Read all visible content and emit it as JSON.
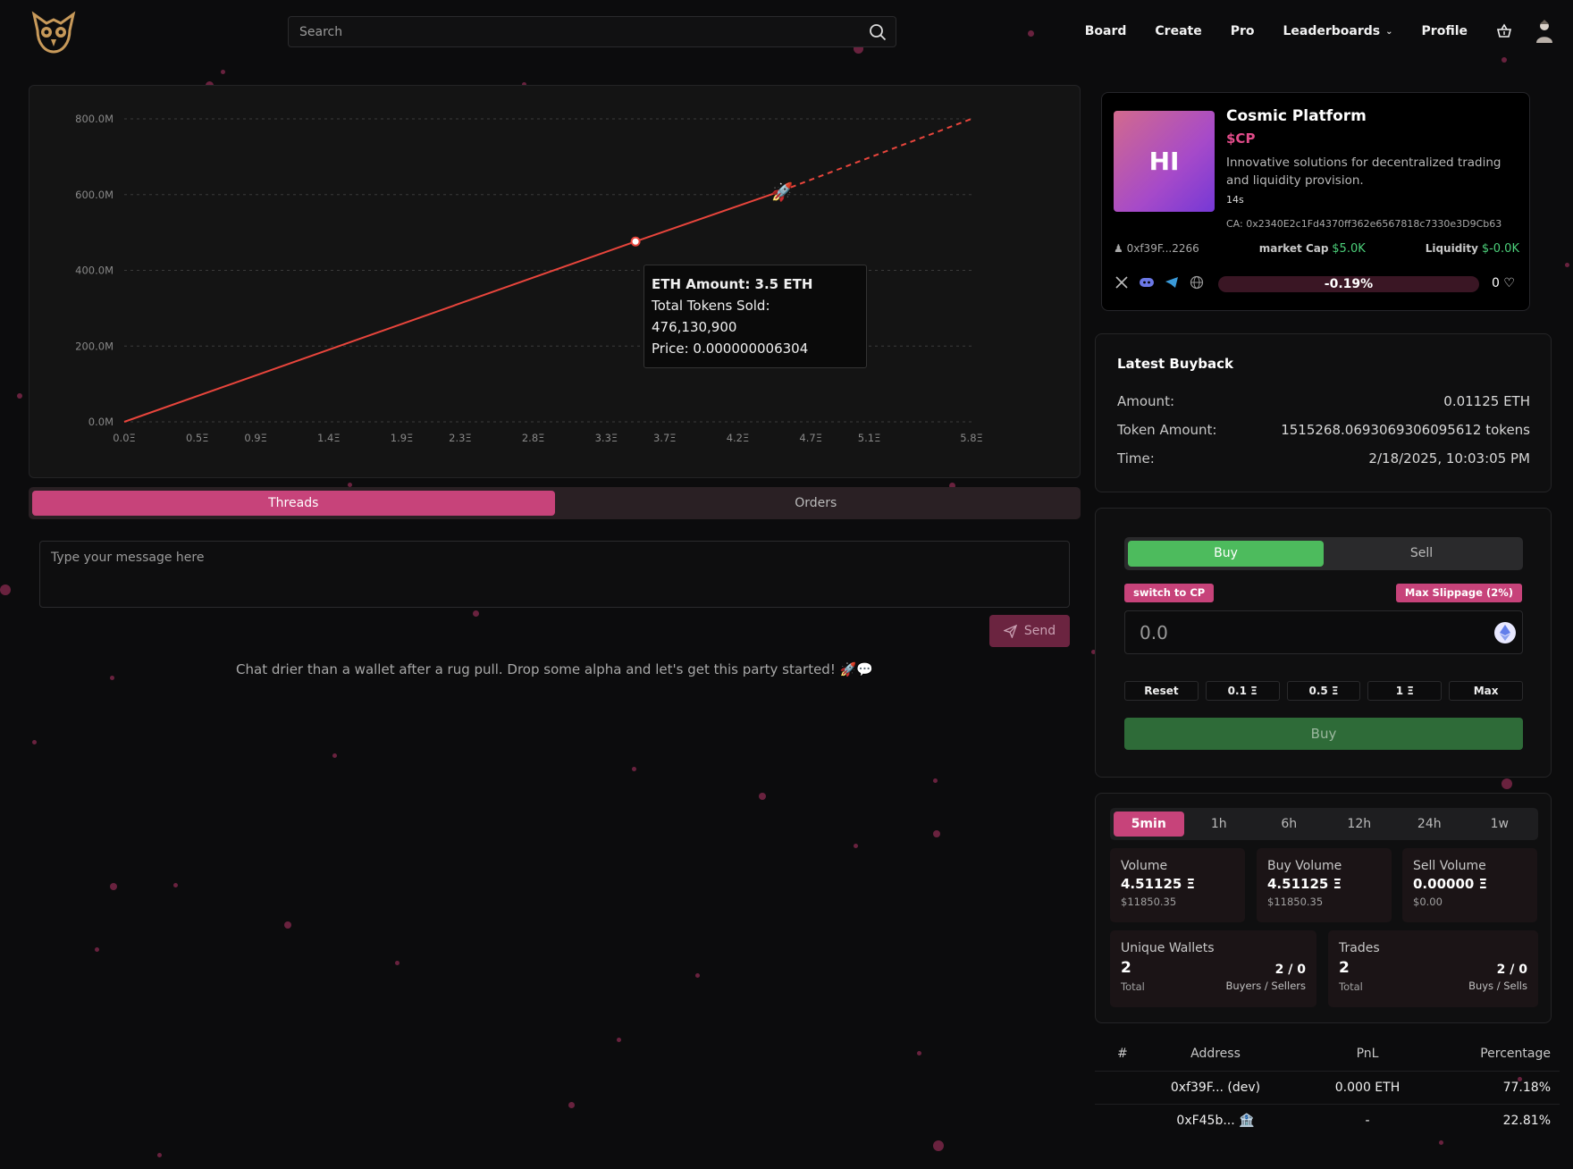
{
  "header": {
    "search_placeholder": "Search",
    "nav": [
      {
        "label": "Board"
      },
      {
        "label": "Create"
      },
      {
        "label": "Pro"
      },
      {
        "label": "Leaderboards"
      },
      {
        "label": "Profile"
      }
    ]
  },
  "chart_data": {
    "type": "line",
    "x": [
      0.0,
      3.5,
      4.5,
      5.8
    ],
    "series": [
      {
        "values": [
          0.0,
          476130900,
          610000000,
          800000000
        ]
      }
    ],
    "x_tick_labels": [
      "0.0Ξ",
      "0.5Ξ",
      "0.9Ξ",
      "1.4Ξ",
      "1.9Ξ",
      "2.3Ξ",
      "2.8Ξ",
      "3.3Ξ",
      "3.7Ξ",
      "4.2Ξ",
      "4.7Ξ",
      "5.1Ξ",
      "5.8Ξ"
    ],
    "y_tick_labels": [
      "0.0M",
      "200.0M",
      "400.0M",
      "600.0M",
      "800.0M"
    ],
    "ylim": [
      0,
      800000000
    ],
    "xlim": [
      0,
      5.8
    ],
    "grid": true,
    "colors": {
      "line": "#e8453c",
      "grid": "#3a3a3a"
    },
    "tooltip": {
      "line1": "ETH Amount: 3.5 ETH",
      "line2": "Total Tokens Sold: 476,130,900",
      "line3": "Price: 0.000000006304"
    },
    "marker_icon": "rocket-icon"
  },
  "tabs": [
    {
      "label": "Threads",
      "active": true
    },
    {
      "label": "Orders",
      "active": false
    }
  ],
  "chat": {
    "placeholder": "Type your message here",
    "send_label": "Send",
    "empty_text": "Chat drier than a wallet after a rug pull. Drop some alpha and let's get this party started! 🚀💬"
  },
  "token": {
    "image_text": "HI",
    "name": "Cosmic Platform",
    "ticker": "$CP",
    "description": "Innovative solutions for decentralized trading and liquidity provision.",
    "age": "14s",
    "ca": "CA: 0x2340E2c1Fd4370ff362e6567818c7330e3D9Cb63",
    "creator": "0xf39F...2266",
    "market_cap_label": "market Cap",
    "market_cap": "$5.0K",
    "liquidity_label": "Liquidity",
    "liquidity": "$-0.0K",
    "change": "-0.19%",
    "likes": "0",
    "colors": {
      "ticker": "#e24c8a",
      "positive": "#4cd07a"
    }
  },
  "buyback": {
    "title": "Latest Buyback",
    "rows": [
      {
        "label": "Amount:",
        "value": "0.01125 ETH"
      },
      {
        "label": "Token Amount:",
        "value": "1515268.0693069306095612 tokens"
      },
      {
        "label": "Time:",
        "value": "2/18/2025, 10:03:05 PM"
      }
    ]
  },
  "trade": {
    "buy_tab": "Buy",
    "sell_tab": "Sell",
    "switch_label": "switch to CP",
    "slippage_label": "Max Slippage (2%)",
    "amount_placeholder": "0.0",
    "quick": [
      "Reset",
      "0.1 Ξ",
      "0.5 Ξ",
      "1 Ξ",
      "Max"
    ],
    "buy_button": "Buy"
  },
  "metrics": {
    "timeframes": [
      {
        "label": "5min",
        "active": true
      },
      {
        "label": "1h"
      },
      {
        "label": "6h"
      },
      {
        "label": "12h"
      },
      {
        "label": "24h"
      },
      {
        "label": "1w"
      }
    ],
    "volume": {
      "title": "Volume",
      "value": "4.51125 Ξ",
      "usd": "$11850.35"
    },
    "buy_volume": {
      "title": "Buy Volume",
      "value": "4.51125 Ξ",
      "usd": "$11850.35"
    },
    "sell_volume": {
      "title": "Sell Volume",
      "value": "0.00000 Ξ",
      "usd": "$0.00"
    },
    "unique_wallets": {
      "title": "Unique Wallets",
      "value": "2",
      "sub": "Total",
      "ratio": "2 / 0",
      "ratio_label": "Buyers / Sellers"
    },
    "trades": {
      "title": "Trades",
      "value": "2",
      "sub": "Total",
      "ratio": "2 / 0",
      "ratio_label": "Buys / Sells"
    }
  },
  "holders": {
    "headers": [
      "#",
      "Address",
      "PnL",
      "Percentage"
    ],
    "rows": [
      {
        "address": "0xf39F... (dev)",
        "pnl": "0.000 ETH",
        "pct": "77.18%"
      },
      {
        "address": "0xF45b... 🏦",
        "pnl": "-",
        "pct": "22.81%"
      }
    ]
  }
}
